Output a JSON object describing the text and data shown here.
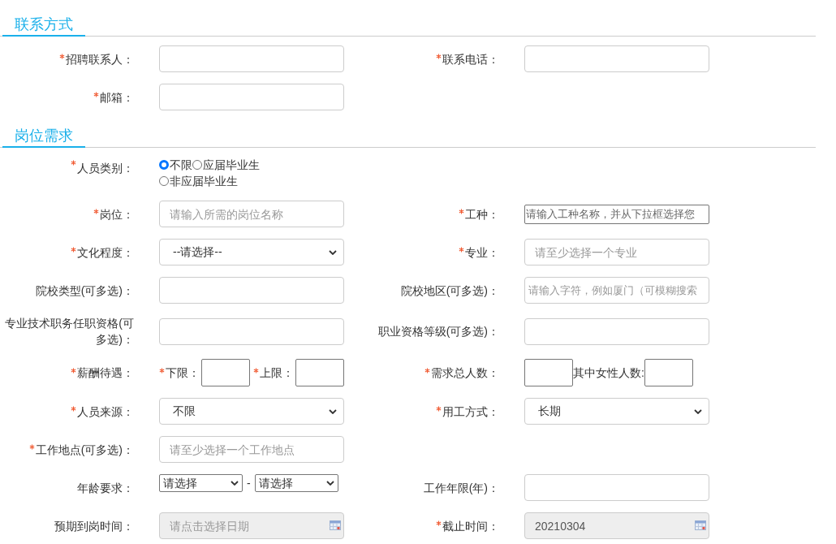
{
  "sections": [
    {
      "title": "联系方式",
      "rows": [
        {
          "cells": [
            {
              "label": "招聘联系人：",
              "required": true,
              "kind": "text"
            },
            {
              "label": "联系电话：",
              "required": true,
              "kind": "text"
            }
          ]
        },
        {
          "cells": [
            {
              "label": "邮箱：",
              "required": true,
              "kind": "text"
            }
          ]
        }
      ]
    },
    {
      "title": "岗位需求",
      "rows": [
        {
          "cells": [
            {
              "label": "人员类别：",
              "required": true,
              "kind": "radio",
              "options": [
                {
                  "label": "不限",
                  "selected": true
                },
                {
                  "label": "应届毕业生",
                  "selected": false
                },
                {
                  "label": "非应届毕业生",
                  "selected": false
                }
              ]
            }
          ]
        },
        {
          "cells": [
            {
              "label": "岗位：",
              "required": true,
              "kind": "text",
              "placeholder": "请输入所需的岗位名称"
            },
            {
              "label": "工种：",
              "required": true,
              "kind": "combo",
              "placeholder": "请输入工种名称，并从下拉框选择您"
            }
          ]
        },
        {
          "cells": [
            {
              "label": "文化程度：",
              "required": true,
              "kind": "select",
              "value": "--请选择--"
            },
            {
              "label": "专业：",
              "required": true,
              "kind": "text",
              "placeholder": "请至少选择一个专业"
            }
          ]
        },
        {
          "cells": [
            {
              "label": "院校类型(可多选)：",
              "required": false,
              "kind": "text"
            },
            {
              "label": "院校地区(可多选)：",
              "required": false,
              "kind": "text",
              "placeholder": "请输入字符，例如厦门（可模糊搜索"
            }
          ]
        },
        {
          "cells": [
            {
              "label": "专业技术职务任职资格(可多选)：",
              "required": false,
              "kind": "text"
            },
            {
              "label": "职业资格等级(可多选)：",
              "required": false,
              "kind": "text"
            }
          ]
        },
        {
          "cells": [
            {
              "label": "薪酬待遇：",
              "required": true,
              "kind": "range",
              "parts": [
                {
                  "label": "下限：",
                  "required": true
                },
                {
                  "label": "上限：",
                  "required": true
                }
              ]
            },
            {
              "label": "需求总人数：",
              "required": true,
              "kind": "count",
              "sub_label": "其中女性人数:"
            }
          ]
        },
        {
          "cells": [
            {
              "label": "人员来源：",
              "required": true,
              "kind": "select",
              "value": "不限"
            },
            {
              "label": "用工方式：",
              "required": true,
              "kind": "select",
              "value": "长期"
            }
          ]
        },
        {
          "cells": [
            {
              "label": "工作地点(可多选)：",
              "required": true,
              "kind": "text",
              "placeholder": "请至少选择一个工作地点"
            }
          ]
        },
        {
          "cells": [
            {
              "label": "年龄要求：",
              "required": false,
              "kind": "age",
              "selects": [
                "请选择",
                "请选择"
              ],
              "separator": "-"
            },
            {
              "label": "工作年限(年)：",
              "required": false,
              "kind": "text"
            }
          ]
        },
        {
          "cells": [
            {
              "label": "预期到岗时间：",
              "required": false,
              "kind": "date",
              "placeholder": "请点击选择日期"
            },
            {
              "label": "截止时间：",
              "required": true,
              "kind": "date",
              "value": "20210304"
            }
          ]
        }
      ]
    }
  ]
}
